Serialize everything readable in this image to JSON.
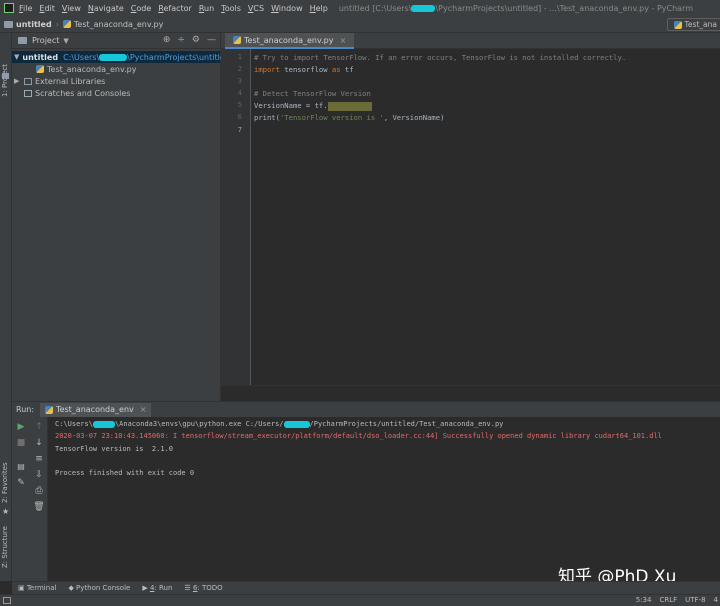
{
  "menubar": {
    "items": [
      "File",
      "Edit",
      "View",
      "Navigate",
      "Code",
      "Refactor",
      "Run",
      "Tools",
      "VCS",
      "Window",
      "Help"
    ],
    "window_title": "untitled [C:\\Users\\",
    "window_title_rest": "\\PycharmProjects\\untitled] - ...\\Test_anaconda_env.py - PyCharm"
  },
  "navbar": {
    "project": "untitled",
    "file": "Test_anaconda_env.py",
    "run_config": "Test_ana"
  },
  "left_strip": {
    "project_label": "1: Project",
    "favorites_label": "2: Favorites",
    "structure_label": "Z: Structure"
  },
  "project_panel": {
    "title": "Project",
    "tree": {
      "root_name": "untitled",
      "root_path_pre": "C:\\Users\\",
      "root_path_post": "\\PycharmProjects\\untitled",
      "file": "Test_anaconda_env.py",
      "external": "External Libraries",
      "scratches": "Scratches and Consoles"
    }
  },
  "editor": {
    "tab": "Test_anaconda_env.py",
    "line_numbers": [
      "1",
      "2",
      "3",
      "4",
      "5",
      "6",
      "7"
    ],
    "code": {
      "l1": "# Try to import TensorFlow. If an error occurs, TensorFlow is not installed correctly.",
      "l2_kw": "import",
      "l2_mod": " tensorflow ",
      "l2_as": "as",
      "l2_alias": " tf",
      "l4": "# Detect TensorFlow Version",
      "l5": "VersionName = tf.",
      "l6_fn": "print(",
      "l6_str": "'TensorFlow version is '",
      "l6_rest": ", VersionName)"
    }
  },
  "run_panel": {
    "label": "Run:",
    "tab": "Test_anaconda_env",
    "console": {
      "cmd_pre": "C:\\Users\\",
      "cmd_mid": "\\Anaconda3\\envs\\gpu\\python.exe C:/Users/",
      "cmd_post": "/PycharmProjects/untitled/Test_anaconda_env.py",
      "log": "2020-03-07 23:10:43.145060: I tensorflow/stream_executor/platform/default/dso_loader.cc:44] Successfully opened dynamic library cudart64_101.dll",
      "version": "TensorFlow version is  2.1.0",
      "exit": "Process finished with exit code 0"
    }
  },
  "bottom_tabs": {
    "terminal": "Terminal",
    "python_console": "Python Console",
    "run_num": "4",
    "run": ": Run",
    "todo_num": "6",
    "todo": ": TODO"
  },
  "status": {
    "position": "5:34",
    "line_sep": "CRLF",
    "encoding": "UTF-8",
    "indent": "4"
  },
  "watermark": "知乎 @PhD Xu",
  "colors": {
    "accent": "#4a88c7",
    "selection": "#0d293e",
    "redaction": "#16c7d8",
    "error_text": "#e36b6b"
  }
}
